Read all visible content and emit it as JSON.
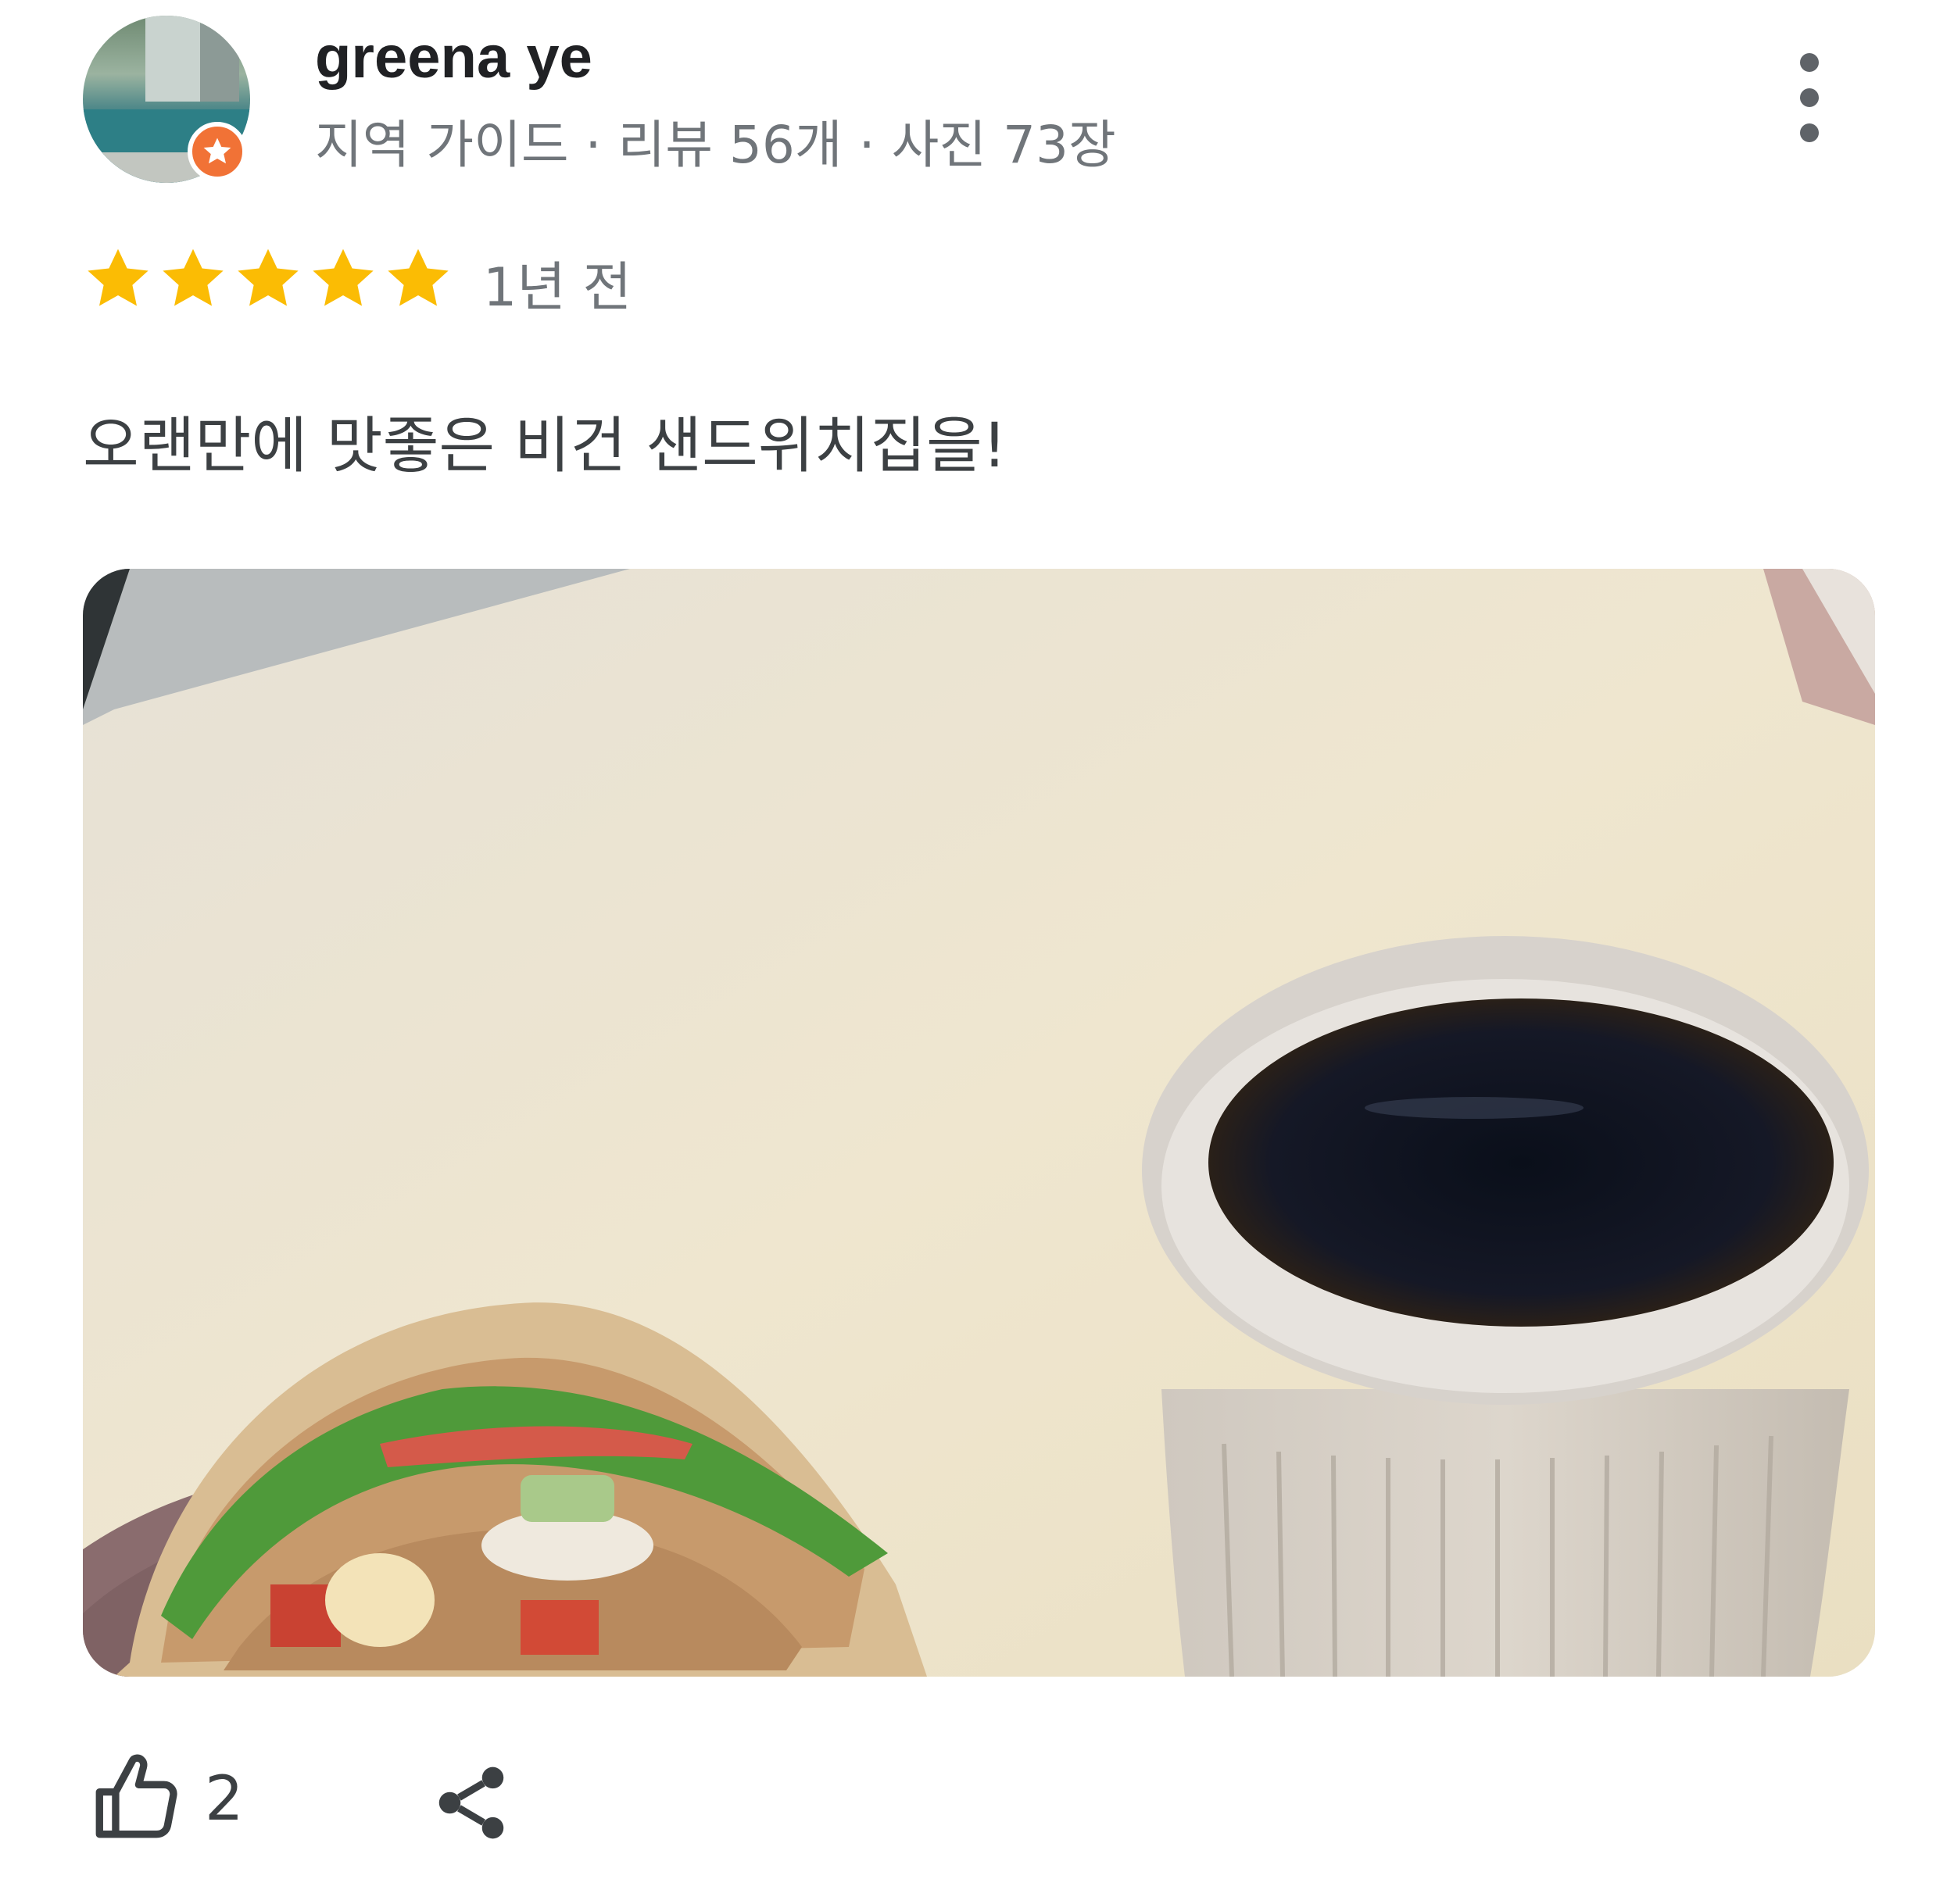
{
  "reviewer": {
    "name": "greena ye",
    "meta": "지역 가이드 · 리뷰 56개 · 사진 73장",
    "avatar_icon": "profile-photo-pool",
    "badge_icon": "local-guide-star-icon",
    "badge_color": "#f17236"
  },
  "rating": {
    "stars": 5,
    "star_color": "#fbbc04",
    "time": "1년 전"
  },
  "review": {
    "text": "오랜만에 맛좋은 비건 샌드위치집을!"
  },
  "photo": {
    "alt": "sandwich and coffee"
  },
  "actions": {
    "like_icon": "thumbs-up-icon",
    "like_count": "2",
    "share_icon": "share-icon",
    "more_icon": "more-vert-icon"
  }
}
